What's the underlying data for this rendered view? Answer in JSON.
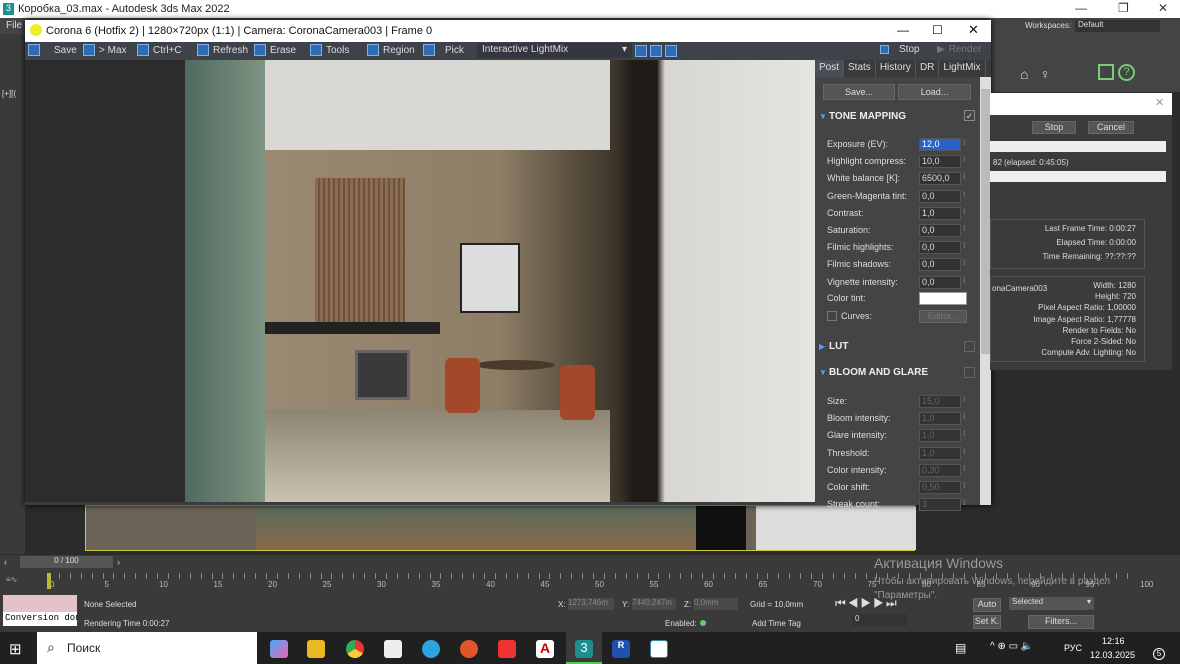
{
  "max": {
    "title": "Коробка_03.max - Autodesk 3ds Max 2022",
    "menu_file": "File",
    "workspaces_label": "Workspaces:",
    "workspaces_value": "Default",
    "viewport_label": "[+][("
  },
  "corona": {
    "title": "Corona 6 (Hotfix 2) | 1280×720px (1:1) | Camera: CoronaCamera003 | Frame 0",
    "toolbar": {
      "save": "Save",
      "to_max": "> Max",
      "copy": "Ctrl+C",
      "refresh": "Refresh",
      "erase": "Erase",
      "tools": "Tools",
      "region": "Region",
      "pick": "Pick",
      "lightmix": "Interactive LightMix",
      "stop": "Stop",
      "render": "Render"
    },
    "tabs": [
      "Post",
      "Stats",
      "History",
      "DR",
      "LightMix"
    ],
    "save_btn": "Save...",
    "load_btn": "Load...",
    "tone_mapping": {
      "title": "TONE MAPPING",
      "enabled": true,
      "rows": [
        {
          "label": "Exposure (EV):",
          "value": "12,0"
        },
        {
          "label": "Highlight compress:",
          "value": "10,0"
        },
        {
          "label": "White balance [K]:",
          "value": "6500,0"
        },
        {
          "label": "Green-Magenta tint:",
          "value": "0,0"
        },
        {
          "label": "Contrast:",
          "value": "1,0"
        },
        {
          "label": "Saturation:",
          "value": "0,0"
        },
        {
          "label": "Filmic highlights:",
          "value": "0,0"
        },
        {
          "label": "Filmic shadows:",
          "value": "0,0"
        },
        {
          "label": "Vignette intensity:",
          "value": "0,0"
        }
      ],
      "color_tint": "Color tint:",
      "color_tint_value": "#ffffff",
      "curves": "Curves:",
      "editor": "Editor..."
    },
    "lut": {
      "title": "LUT",
      "enabled": false
    },
    "bloom": {
      "title": "BLOOM AND GLARE",
      "enabled": false,
      "rows": [
        {
          "label": "Size:",
          "value": "15,0"
        },
        {
          "label": "Bloom intensity:",
          "value": "1,0"
        },
        {
          "label": "Glare intensity:",
          "value": "1,0"
        },
        {
          "label": "Threshold:",
          "value": "1,0"
        },
        {
          "label": "Color intensity:",
          "value": "0,30"
        },
        {
          "label": "Color shift:",
          "value": "0,50"
        },
        {
          "label": "Streak count:",
          "value": "3"
        }
      ]
    }
  },
  "progress": {
    "stop": "Stop",
    "cancel": "Cancel",
    "status": "82 (elapsed: 0:45:05)",
    "times": [
      {
        "label": "Last Frame Time:",
        "value": "0:00:27"
      },
      {
        "label": "Elapsed Time:",
        "value": "0:00:00"
      },
      {
        "label": "Time Remaining:",
        "value": "??:??:??"
      }
    ],
    "camera": "onaCamera003",
    "params": [
      {
        "label": "Width:",
        "value": "1280"
      },
      {
        "label": "Height:",
        "value": "720"
      },
      {
        "label": "Pixel Aspect Ratio:",
        "value": "1,00000"
      },
      {
        "label": "Image Aspect Ratio:",
        "value": "1,77778"
      },
      {
        "label": "Render to Fields:",
        "value": "No"
      },
      {
        "label": "Force 2-Sided:",
        "value": "No"
      },
      {
        "label": "Compute Adv. Lighting:",
        "value": "No"
      }
    ]
  },
  "timeline": {
    "frame": "0 / 100",
    "ticks": [
      "0",
      "5",
      "10",
      "15",
      "20",
      "25",
      "30",
      "35",
      "40",
      "45",
      "50",
      "55",
      "60",
      "65",
      "70",
      "75",
      "80",
      "85",
      "90",
      "95",
      "100"
    ]
  },
  "status": {
    "conversion": "Conversion don",
    "selection": "None Selected",
    "rendering_time": "Rendering Time  0:00:27",
    "x_label": "X:",
    "x": "1273,746m",
    "y_label": "Y:",
    "y": "7440,247m",
    "z_label": "Z:",
    "z": "0,0mm",
    "grid": "Grid = 10,0mm",
    "enabled": "Enabled:",
    "add_time_tag": "Add Time Tag",
    "frame_field": "0",
    "auto": "Auto",
    "set_key": "Set K.",
    "selected": "Selected",
    "filters": "Filters..."
  },
  "watermark": {
    "title": "Активация Windows",
    "text": "Чтобы активировать Windows, перейдите в раздел \"Параметры\"."
  },
  "taskbar": {
    "search": "Поиск",
    "lang": "РУС",
    "time": "12:16",
    "date": "12.03.2025",
    "notifications": "5"
  }
}
